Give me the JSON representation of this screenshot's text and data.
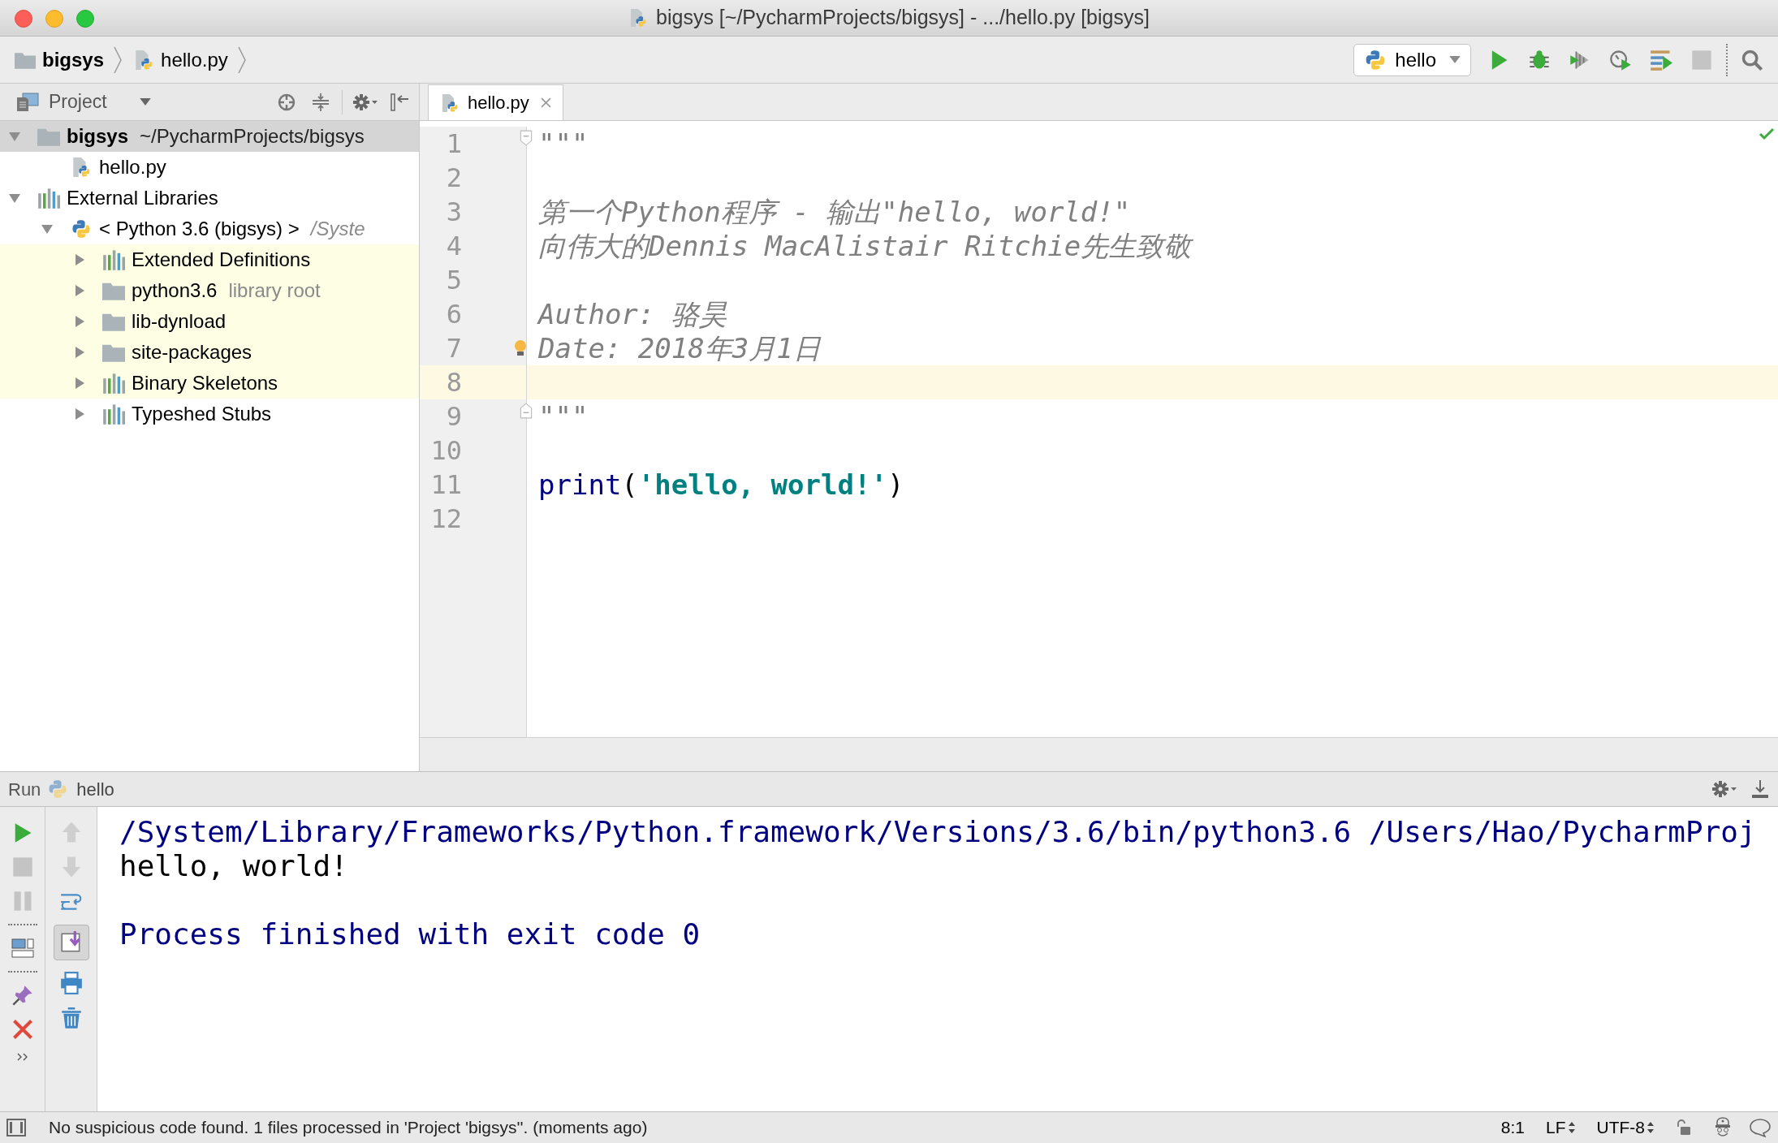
{
  "window": {
    "title": "bigsys [~/PycharmProjects/bigsys] - .../hello.py [bigsys]"
  },
  "breadcrumbs": [
    {
      "label": "bigsys",
      "kind": "folder"
    },
    {
      "label": "hello.py",
      "kind": "python_file"
    }
  ],
  "run_config": {
    "label": "hello"
  },
  "project_panel": {
    "title": "Project",
    "tree": [
      {
        "label": "bigsys",
        "hint": "~/PycharmProjects/bigsys",
        "kind": "project",
        "expanded": true,
        "selected": true,
        "highlighted": false,
        "children": [
          {
            "label": "hello.py",
            "kind": "python_file",
            "selected": false,
            "highlighted": false
          }
        ]
      },
      {
        "label": "External Libraries",
        "kind": "library",
        "expanded": true,
        "selected": false,
        "highlighted": false,
        "children": [
          {
            "label": "< Python 3.6 (bigsys) >",
            "hint": "/Syste",
            "kind": "python",
            "expanded": true,
            "selected": false,
            "highlighted": false,
            "children": [
              {
                "label": "Extended Definitions",
                "kind": "library",
                "expanded": false,
                "selected": false,
                "highlighted": true
              },
              {
                "label": "python3.6",
                "hint": "library root",
                "kind": "folder",
                "expanded": false,
                "selected": false,
                "highlighted": true
              },
              {
                "label": "lib-dynload",
                "kind": "folder",
                "expanded": false,
                "selected": false,
                "highlighted": true
              },
              {
                "label": "site-packages",
                "kind": "folder",
                "expanded": false,
                "selected": false,
                "highlighted": true
              },
              {
                "label": "Binary Skeletons",
                "kind": "library",
                "expanded": false,
                "selected": false,
                "highlighted": true
              },
              {
                "label": "Typeshed Stubs",
                "kind": "library",
                "expanded": false,
                "selected": false,
                "highlighted": false
              }
            ]
          }
        ]
      }
    ]
  },
  "editor": {
    "tabs": [
      {
        "label": "hello.py",
        "selected": true
      }
    ],
    "lines": [
      {
        "number": "1",
        "fold_open": true,
        "current": false,
        "tokens": [
          {
            "text": "\"\"\"",
            "kind": "docstring"
          }
        ]
      },
      {
        "number": "2",
        "current": false
      },
      {
        "number": "3",
        "current": false,
        "tokens": [
          {
            "text": "第一个Python程序 - 输出\"hello, world!\"",
            "kind": "docstring"
          }
        ]
      },
      {
        "number": "4",
        "current": false,
        "tokens": [
          {
            "text": "向伟大的Dennis MacAlistair Ritchie先生致敬",
            "kind": "docstring"
          }
        ]
      },
      {
        "number": "5",
        "current": false
      },
      {
        "number": "6",
        "current": false,
        "tokens": [
          {
            "text": "Author: 骆昊",
            "kind": "docstring"
          }
        ]
      },
      {
        "number": "7",
        "current": false,
        "bulb": true,
        "tokens": [
          {
            "text": "Date: 2018年3月1日",
            "kind": "docstring"
          }
        ]
      },
      {
        "number": "8",
        "current": true
      },
      {
        "number": "9",
        "fold_close": true,
        "current": false,
        "tokens": [
          {
            "text": "\"\"\"",
            "kind": "docstring"
          }
        ]
      },
      {
        "number": "10",
        "current": false
      },
      {
        "number": "11",
        "current": false,
        "tokens": [
          {
            "text": "print",
            "kind": "builtin"
          },
          {
            "text": "(",
            "kind": "plain"
          },
          {
            "text": "'hello, world!'",
            "kind": "string"
          },
          {
            "text": ")",
            "kind": "plain"
          }
        ]
      },
      {
        "number": "12",
        "current": false
      }
    ]
  },
  "run_panel": {
    "title": "Run",
    "tab": "hello",
    "console": [
      {
        "text": "/System/Library/Frameworks/Python.framework/Versions/3.6/bin/python3.6 /Users/Hao/PycharmProj",
        "kind": "command"
      },
      {
        "text": "hello, world!",
        "kind": "stdout"
      },
      {
        "text": "Process finished with exit code 0",
        "kind": "exit"
      }
    ]
  },
  "status_bar": {
    "message": "No suspicious code found. 1 files processed in 'Project 'bigsys''. (moments ago)",
    "position": "8:1",
    "line_separator": "LF",
    "encoding": "UTF-8"
  }
}
